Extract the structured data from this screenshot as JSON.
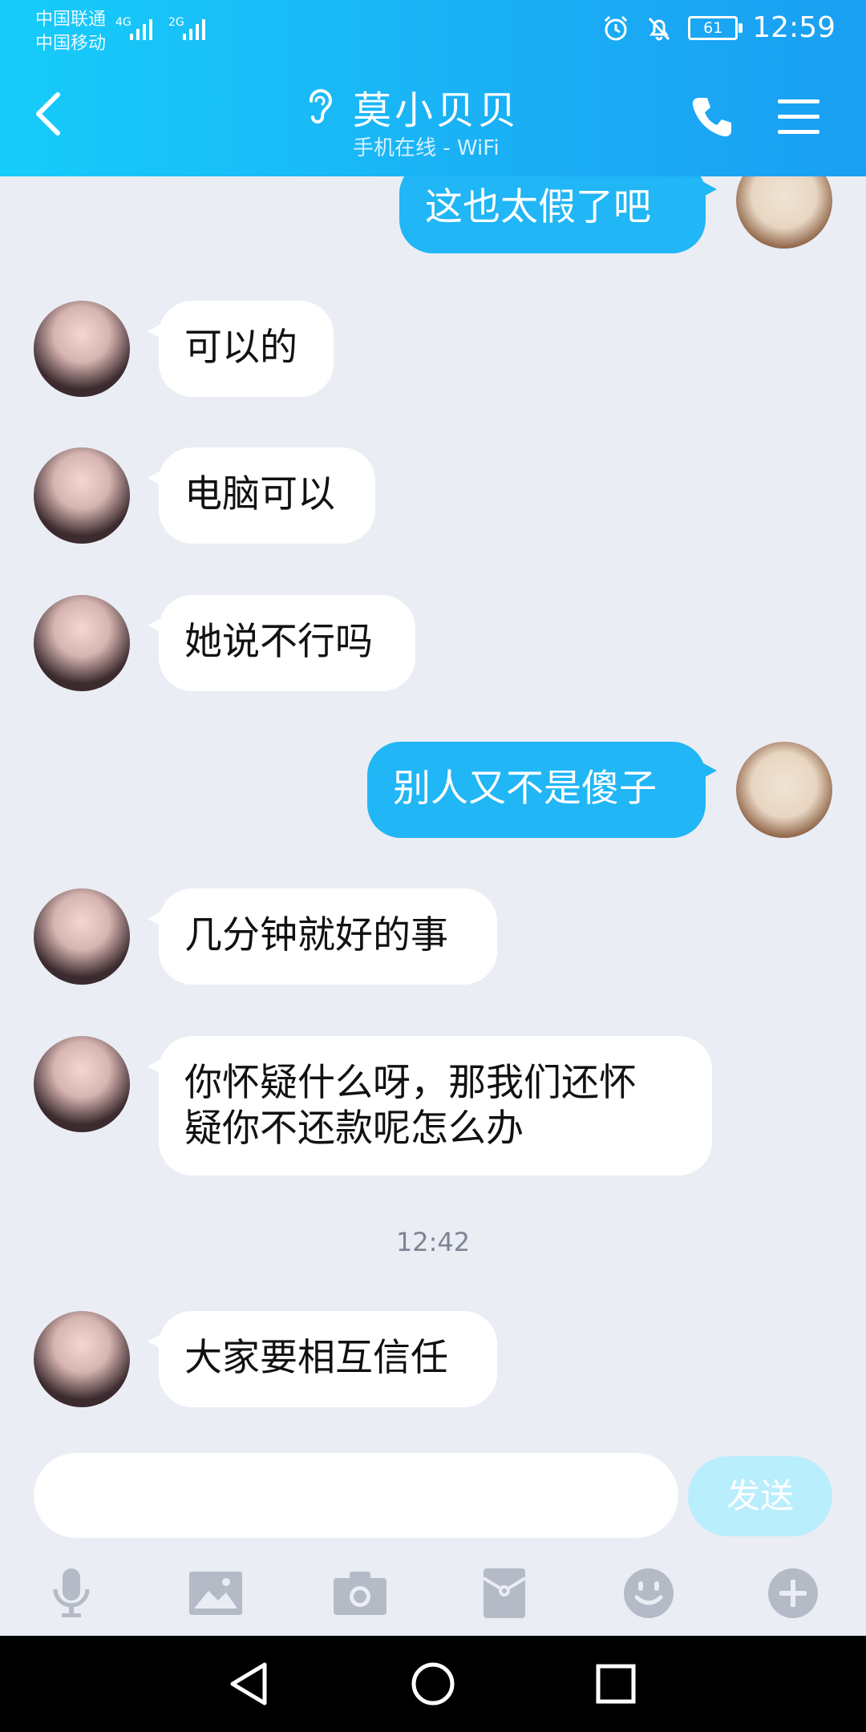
{
  "status_bar": {
    "carrier1": "中国联通",
    "carrier2": "中国移动",
    "net1": "4G",
    "net2": "2G",
    "battery": "61",
    "time": "12:59"
  },
  "header": {
    "title": "莫小贝贝",
    "subtitle": "手机在线 - WiFi"
  },
  "messages": [
    {
      "side": "out",
      "text": "这也太假了吧"
    },
    {
      "side": "in",
      "text": "可以的"
    },
    {
      "side": "in",
      "text": "电脑可以"
    },
    {
      "side": "in",
      "text": "她说不行吗"
    },
    {
      "side": "out",
      "text": "别人又不是傻子"
    },
    {
      "side": "in",
      "text": "几分钟就好的事"
    },
    {
      "side": "in",
      "text": "你怀疑什么呀，那我们还怀",
      "text2": "疑你不还款呢怎么办"
    },
    {
      "side": "in",
      "text": "大家要相互信任"
    }
  ],
  "timestamp": "12:42",
  "input": {
    "placeholder": "",
    "send_label": "发送"
  },
  "toolbar": [
    "mic-icon",
    "image-icon",
    "camera-icon",
    "red-packet-icon",
    "emoji-icon",
    "plus-icon"
  ],
  "colors": {
    "header_start": "#16ccfa",
    "header_end": "#1a9ff2",
    "outgoing_bubble": "#21b6f5",
    "incoming_bubble": "#ffffff",
    "chat_bg": "#eaedf4",
    "send_disabled": "#b9eefd"
  }
}
